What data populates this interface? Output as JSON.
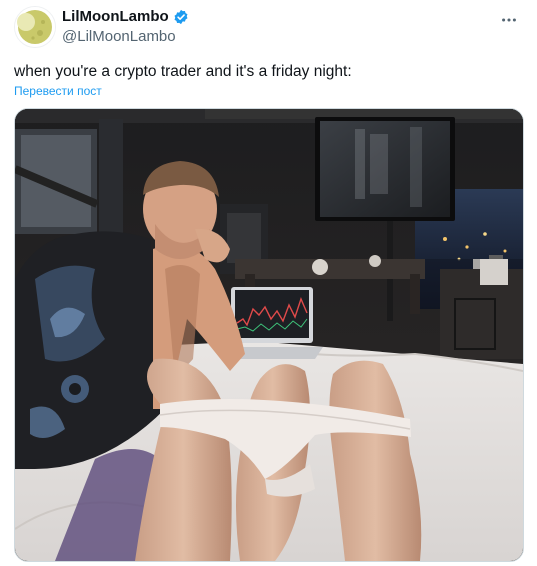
{
  "author": {
    "display_name": "LilMoonLambo",
    "handle": "@LilMoonLambo",
    "verified": true
  },
  "tweet": {
    "text": "when you're a crypto trader and it's a friday night:",
    "translate_label": "Перевести пост"
  },
  "icons": {
    "verified": "verified-badge-icon",
    "more": "more-horizontal-icon",
    "avatar": "moon-avatar"
  },
  "colors": {
    "verified_blue": "#1d9bf0",
    "link_blue": "#1d9bf0",
    "handle_gray": "#536471",
    "avatar_moon": "#c9c96a"
  }
}
